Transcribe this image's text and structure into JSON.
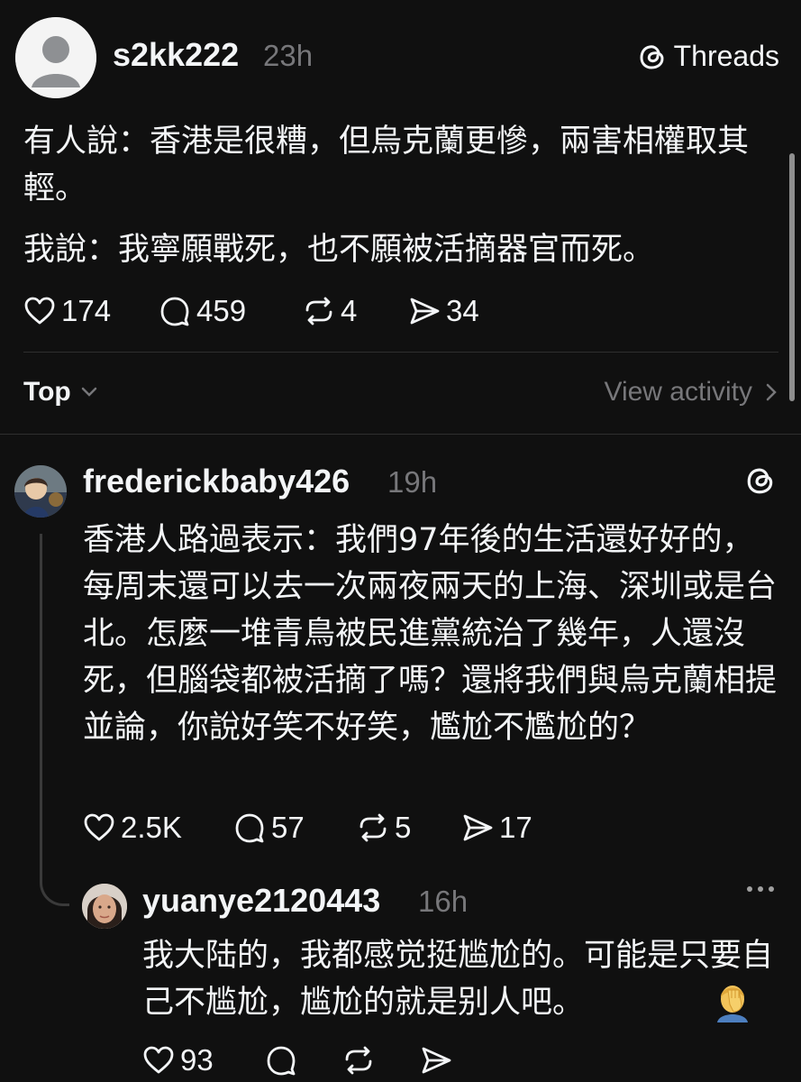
{
  "main_post": {
    "username": "s2kk222",
    "time": "23h",
    "brand": "Threads",
    "paragraphs": [
      "有人說：香港是很糟，但烏克蘭更慘，兩害相權取其輕。",
      "我說：我寧願戰死，也不願被活摘器官而死。"
    ],
    "likes": "174",
    "replies": "459",
    "reposts": "4",
    "shares": "34"
  },
  "sort": {
    "label": "Top",
    "view_activity": "View activity"
  },
  "replies": [
    {
      "username": "frederickbaby426",
      "time": "19h",
      "text": "香港人路過表示：我們97年後的生活還好好的，每周末還可以去一次兩夜兩天的上海、深圳或是台北。怎麼一堆青鳥被民進黨統治了幾年，人還沒死，但腦袋都被活摘了嗎？還將我們與烏克蘭相提並論，你說好笑不好笑，尷尬不尷尬的？",
      "likes": "2.5K",
      "replies": "57",
      "reposts": "5",
      "shares": "17"
    },
    {
      "username": "yuanye2120443",
      "time": "16h",
      "text": "我大陆的，我都感觉挺尴尬的。可能是只要自己不尴尬，尴尬的就是别人吧。",
      "emoji_icon": "facepalm-emoji",
      "likes": "93"
    }
  ],
  "colors": {
    "background": "#101010",
    "text": "#f3f5f7",
    "muted": "#77777a",
    "divider": "#2e2e2e"
  }
}
